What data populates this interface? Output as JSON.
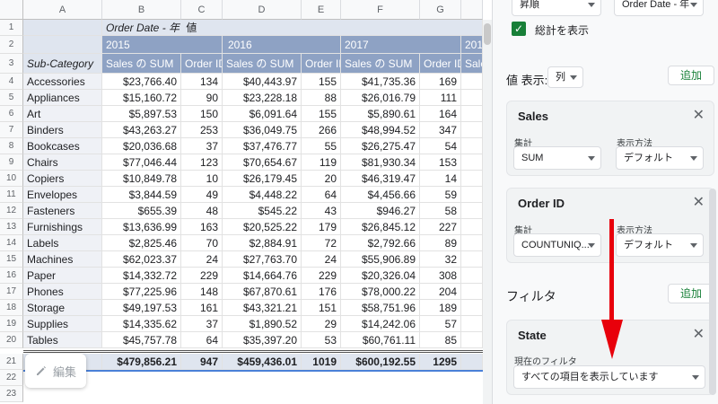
{
  "column_headers": [
    "A",
    "B",
    "C",
    "D",
    "E",
    "F",
    "G"
  ],
  "row_numbers": [
    "1",
    "2",
    "3",
    "4",
    "5",
    "6",
    "7",
    "8",
    "9",
    "10",
    "11",
    "12",
    "13",
    "14",
    "15",
    "16",
    "17",
    "18",
    "19",
    "20",
    "21",
    "22",
    "23"
  ],
  "pivot": {
    "row1_label": "Order Date - 年",
    "row1_value": "値",
    "years": [
      "2015",
      "2016",
      "2017",
      "201"
    ],
    "subcat_header": "Sub-Category",
    "metric_headers": [
      "Sales の SUM",
      "Order ID",
      "Sales の SUM",
      "Order ID",
      "Sales の SUM",
      "Order ID",
      "Sale"
    ],
    "rows": [
      {
        "name": "Accessories",
        "v": [
          "$23,766.40",
          "134",
          "$40,443.97",
          "155",
          "$41,735.36",
          "169"
        ]
      },
      {
        "name": "Appliances",
        "v": [
          "$15,160.72",
          "90",
          "$23,228.18",
          "88",
          "$26,016.79",
          "111"
        ]
      },
      {
        "name": "Art",
        "v": [
          "$5,897.53",
          "150",
          "$6,091.64",
          "155",
          "$5,890.61",
          "164"
        ]
      },
      {
        "name": "Binders",
        "v": [
          "$43,263.27",
          "253",
          "$36,049.75",
          "266",
          "$48,994.52",
          "347"
        ]
      },
      {
        "name": "Bookcases",
        "v": [
          "$20,036.68",
          "37",
          "$37,476.77",
          "55",
          "$26,275.47",
          "54"
        ]
      },
      {
        "name": "Chairs",
        "v": [
          "$77,046.44",
          "123",
          "$70,654.67",
          "119",
          "$81,930.34",
          "153"
        ]
      },
      {
        "name": "Copiers",
        "v": [
          "$10,849.78",
          "10",
          "$26,179.45",
          "20",
          "$46,319.47",
          "14"
        ]
      },
      {
        "name": "Envelopes",
        "v": [
          "$3,844.59",
          "49",
          "$4,448.22",
          "64",
          "$4,456.66",
          "59"
        ]
      },
      {
        "name": "Fasteners",
        "v": [
          "$655.39",
          "48",
          "$545.22",
          "43",
          "$946.27",
          "58"
        ]
      },
      {
        "name": "Furnishings",
        "v": [
          "$13,636.99",
          "163",
          "$20,525.22",
          "179",
          "$26,845.12",
          "227"
        ]
      },
      {
        "name": "Labels",
        "v": [
          "$2,825.46",
          "70",
          "$2,884.91",
          "72",
          "$2,792.66",
          "89"
        ]
      },
      {
        "name": "Machines",
        "v": [
          "$62,023.37",
          "24",
          "$27,763.70",
          "24",
          "$55,906.89",
          "32"
        ]
      },
      {
        "name": "Paper",
        "v": [
          "$14,332.72",
          "229",
          "$14,664.76",
          "229",
          "$20,326.04",
          "308"
        ]
      },
      {
        "name": "Phones",
        "v": [
          "$77,225.96",
          "148",
          "$67,870.61",
          "176",
          "$78,000.22",
          "204"
        ]
      },
      {
        "name": "Storage",
        "v": [
          "$49,197.53",
          "161",
          "$43,321.21",
          "151",
          "$58,751.96",
          "189"
        ]
      },
      {
        "name": "Supplies",
        "v": [
          "$14,335.62",
          "37",
          "$1,890.52",
          "29",
          "$14,242.06",
          "57"
        ]
      },
      {
        "name": "Tables",
        "v": [
          "$45,757.78",
          "64",
          "$35,397.20",
          "53",
          "$60,761.11",
          "85"
        ]
      }
    ],
    "totals": [
      "$479,856.21",
      "947",
      "$459,436.01",
      "1019",
      "$600,192.55",
      "1295"
    ]
  },
  "edit_button": {
    "label": "編集",
    "icon": "pencil-icon"
  },
  "panel": {
    "top_dropdown_left": "昇順",
    "top_dropdown_right": "Order Date - 年",
    "show_totals_label": "総計を表示",
    "values_label": "値 表示:",
    "values_mode": "列",
    "add_label": "追加",
    "value_cards": [
      {
        "title": "Sales",
        "agg_label": "集計",
        "agg_value": "SUM",
        "show_label": "表示方法",
        "show_value": "デフォルト"
      },
      {
        "title": "Order ID",
        "agg_label": "集計",
        "agg_value": "COUNTUNIQ...",
        "show_label": "表示方法",
        "show_value": "デフォルト"
      }
    ],
    "filter_label": "フィルタ",
    "filter_add_label": "追加",
    "filter_card": {
      "title": "State",
      "current_label": "現在のフィルタ",
      "current_value": "すべての項目を表示しています"
    }
  },
  "colors": {
    "accent_green": "#188038",
    "annotation_red": "#e8000b",
    "header_blue": "#8ea2c4"
  }
}
